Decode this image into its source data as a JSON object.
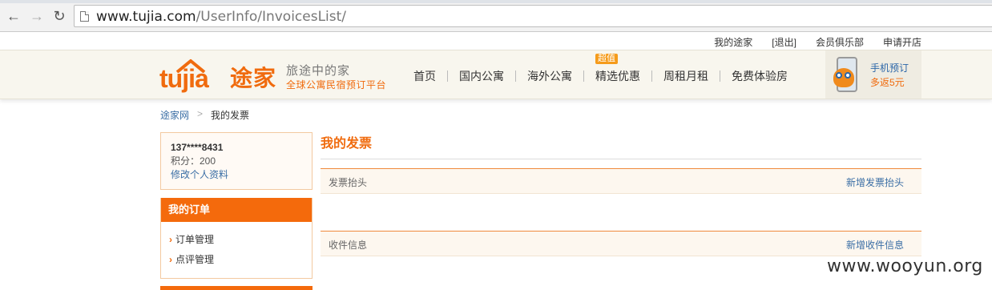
{
  "browser": {
    "url_host": "www.tujia.com",
    "url_path": "/UserInfo/InvoicesList/"
  },
  "toplinks": [
    "我的途家",
    "[退出]",
    "会员俱乐部",
    "申请开店"
  ],
  "header": {
    "logo_latin": "tujia",
    "logo_cn": "途家",
    "tagline_1": "旅途中的家",
    "tagline_2": "全球公寓民宿预订平台",
    "nav": [
      "首页",
      "国内公寓",
      "海外公寓",
      "精选优惠",
      "周租月租",
      "免费体验房"
    ],
    "badge": "超值",
    "promo_line_1": "手机预订",
    "promo_line_2": "多返5元"
  },
  "breadcrumb": {
    "home": "途家网",
    "sep": ">",
    "current": "我的发票"
  },
  "user": {
    "name": "137****8431",
    "points": "积分：200",
    "edit_link": "修改个人资料"
  },
  "orders": {
    "title": "我的订单",
    "items": [
      "订单管理",
      "点评管理"
    ]
  },
  "main": {
    "title": "我的发票",
    "sections": [
      {
        "label": "发票抬头",
        "action": "新增发票抬头"
      },
      {
        "label": "收件信息",
        "action": "新增收件信息"
      }
    ]
  },
  "watermark": "www.wooyun.org",
  "colors": {
    "brand_orange": "#f06b0e",
    "link_blue": "#3a6ea5",
    "header_bg": "#f8f6ee"
  }
}
